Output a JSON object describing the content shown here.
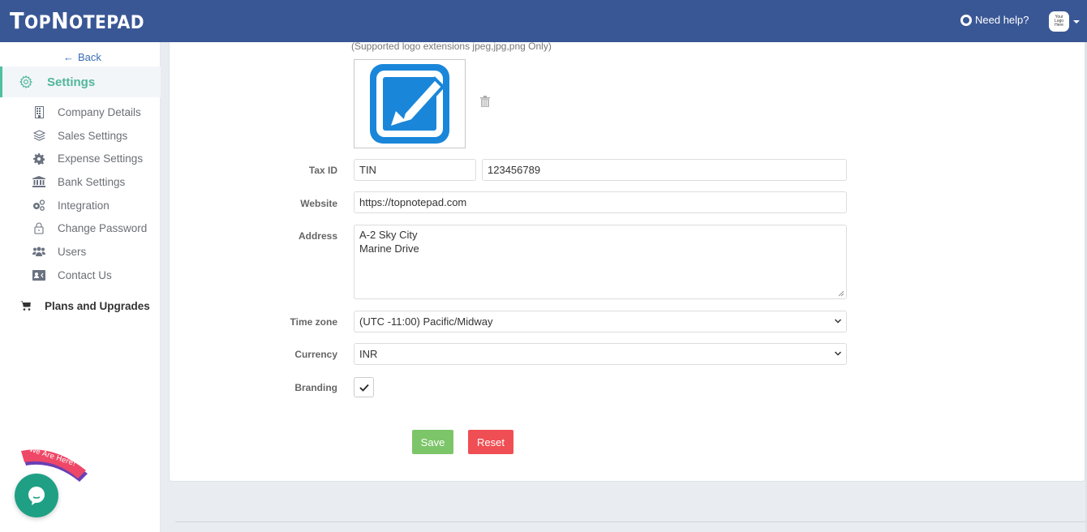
{
  "header": {
    "brand_big_t": "T",
    "brand_op": "OP",
    "brand_big_n": "N",
    "brand_rest": "OTEPAD",
    "help_label": "Need help?",
    "avatar_text": "Your Logo Here",
    "bg_color": "#3a5795"
  },
  "sidebar": {
    "back_label": "Back",
    "active_section": "Settings",
    "items": [
      {
        "label": "Company Details",
        "icon": "building-icon"
      },
      {
        "label": "Sales Settings",
        "icon": "layers-icon"
      },
      {
        "label": "Expense Settings",
        "icon": "cog-icon"
      },
      {
        "label": "Bank Settings",
        "icon": "bank-icon"
      },
      {
        "label": "Integration",
        "icon": "cogs-icon"
      },
      {
        "label": "Change Password",
        "icon": "lock-icon"
      },
      {
        "label": "Users",
        "icon": "users-icon"
      },
      {
        "label": "Contact Us",
        "icon": "contact-card-icon"
      }
    ],
    "plans_label": "Plans and Upgrades",
    "accent_color": "#4fb79a"
  },
  "form": {
    "logo_hint": "(Supported logo extensions jpeg,jpg,png Only)",
    "tax_id": {
      "label": "Tax ID",
      "type_value": "TIN",
      "number_value": "123456789"
    },
    "website": {
      "label": "Website",
      "value": "https://topnotepad.com"
    },
    "address": {
      "label": "Address",
      "value": "A-2 Sky City\nMarine Drive"
    },
    "timezone": {
      "label": "Time zone",
      "value": "(UTC -11:00) Pacific/Midway"
    },
    "currency": {
      "label": "Currency",
      "value": "INR"
    },
    "branding": {
      "label": "Branding",
      "checked": true
    },
    "save_label": "Save",
    "reset_label": "Reset",
    "save_color": "#7dc569",
    "reset_color": "#ef4e54"
  },
  "chat": {
    "badge_text": "We Are Here!"
  }
}
